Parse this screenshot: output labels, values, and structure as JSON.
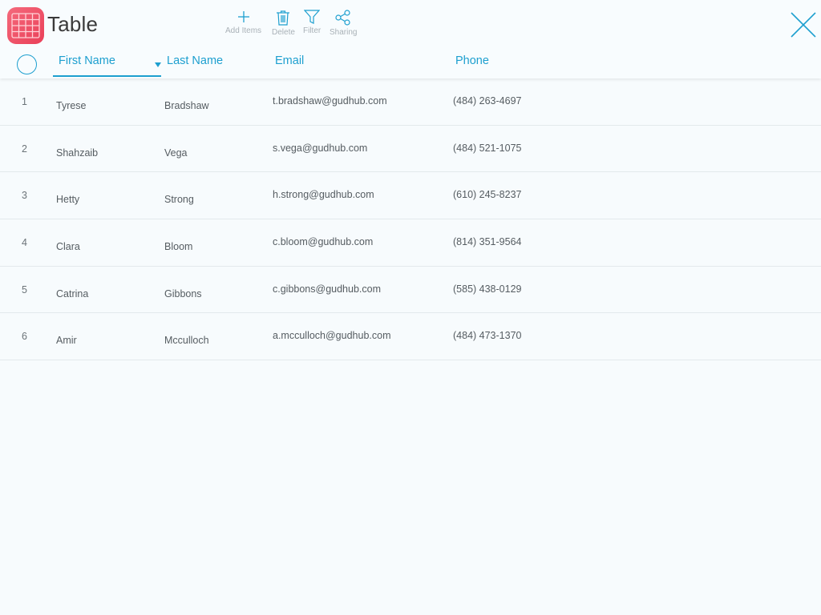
{
  "app": {
    "title": "Table",
    "icon": "table-icon",
    "accent_color": "#1d9fcf",
    "icon_color": "#ee4b63"
  },
  "toolbar": {
    "add_label": "Add Items",
    "delete_label": "Delete",
    "filter_label": "Filter",
    "sharing_label": "Sharing"
  },
  "columns": {
    "first_name": "First Name",
    "last_name": "Last Name",
    "email": "Email",
    "phone": "Phone",
    "sorted_by": "First Name"
  },
  "rows": [
    {
      "num": "1",
      "first": "Tyrese",
      "last": "Bradshaw",
      "email": "t.bradshaw@gudhub.com",
      "phone": "(484) 263-4697"
    },
    {
      "num": "2",
      "first": "Shahzaib",
      "last": "Vega",
      "email": "s.vega@gudhub.com",
      "phone": "(484) 521-1075"
    },
    {
      "num": "3",
      "first": "Hetty",
      "last": "Strong",
      "email": "h.strong@gudhub.com",
      "phone": "(610) 245-8237"
    },
    {
      "num": "4",
      "first": "Clara",
      "last": "Bloom",
      "email": "c.bloom@gudhub.com",
      "phone": "(814) 351-9564"
    },
    {
      "num": "5",
      "first": "Catrina",
      "last": "Gibbons",
      "email": "c.gibbons@gudhub.com",
      "phone": "(585) 438-0129"
    },
    {
      "num": "6",
      "first": "Amir",
      "last": "Mcculloch",
      "email": "a.mcculloch@gudhub.com",
      "phone": "(484) 473-1370"
    }
  ]
}
